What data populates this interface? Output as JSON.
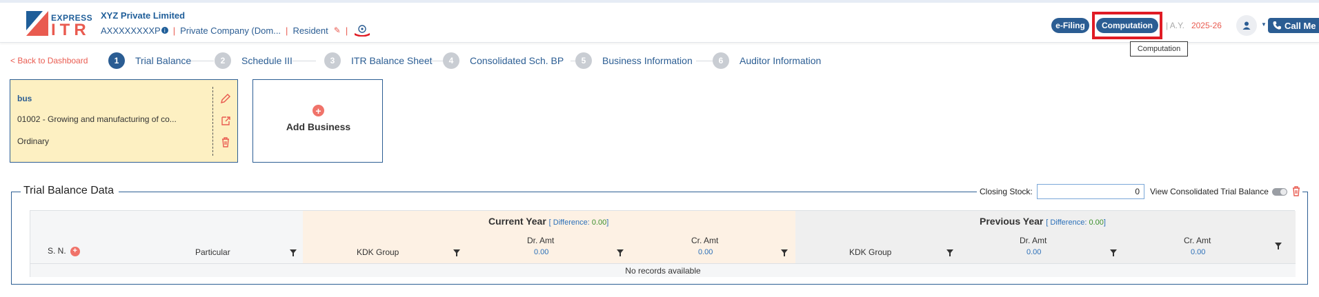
{
  "brand": {
    "logo_top": "EXPRESS",
    "logo_bottom": "ITR"
  },
  "header": {
    "company": "XYZ Private Limited",
    "pan": "AXXXXXXXXP",
    "pan_info": "i",
    "company_type": "Private Company (Dom...",
    "residency": "Resident",
    "efiling_label": "e-Filing",
    "computation_label": "Computation",
    "tooltip": "Computation",
    "ay_label": "A.Y.",
    "ay_value": "2025-26",
    "call_label": "Call Me"
  },
  "steps": {
    "back_label": "< Back to Dashboard",
    "items": [
      {
        "num": "1",
        "label": "Trial Balance"
      },
      {
        "num": "2",
        "label": "Schedule III"
      },
      {
        "num": "3",
        "label": "ITR Balance Sheet"
      },
      {
        "num": "4",
        "label": "Consolidated Sch. BP"
      },
      {
        "num": "5",
        "label": "Business Information"
      },
      {
        "num": "6",
        "label": "Auditor Information"
      }
    ]
  },
  "business": {
    "name": "bus",
    "code": "01002 - Growing and manufacturing of co...",
    "type": "Ordinary",
    "add_label": "Add Business"
  },
  "trial_balance": {
    "title": "Trial Balance Data",
    "closing_stock_label": "Closing Stock:",
    "closing_stock_value": "0",
    "view_consolidated_label": "View Consolidated Trial Balance",
    "current_year_label": "Current Year",
    "previous_year_label": "Previous Year",
    "difference_label": "[ Difference:",
    "current_difference": "0.00",
    "previous_difference": "0.00",
    "difference_close": "]",
    "sn_label": "S. N.",
    "particular_label": "Particular",
    "kdk_group_label": "KDK Group",
    "dr_amt_label": "Dr. Amt",
    "cr_amt_label": "Cr. Amt",
    "cy_dr_total": "0.00",
    "cy_cr_total": "0.00",
    "py_dr_total": "0.00",
    "py_cr_total": "0.00",
    "no_records": "No records available"
  },
  "colors": {
    "primary": "#2b5d93",
    "accent": "#e95b50",
    "card_bg": "#fdf0c2",
    "highlight": "#e01b24"
  }
}
